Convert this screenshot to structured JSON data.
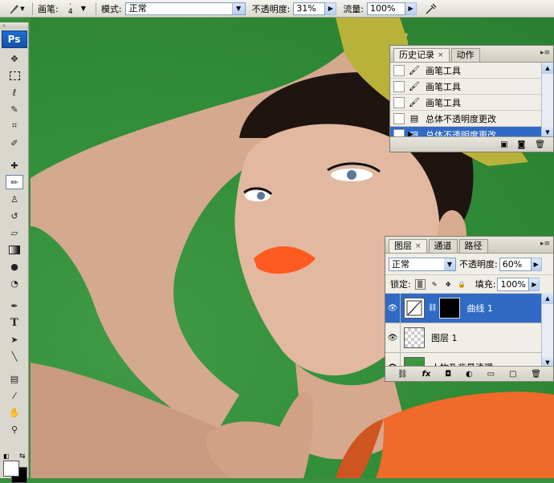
{
  "options_bar": {
    "brush_label": "画笔:",
    "brush_size": "4",
    "mode_label": "模式:",
    "mode_value": "正常",
    "opacity_label": "不透明度:",
    "opacity_value": "31%",
    "flow_label": "流量:",
    "flow_value": "100%"
  },
  "toolbox": {
    "logo": "Ps"
  },
  "history_panel": {
    "tabs": [
      {
        "label": "历史记录",
        "active": true
      },
      {
        "label": "动作",
        "active": false
      }
    ],
    "items": [
      {
        "label": "画笔工具",
        "icon": "brush-icon",
        "selected": false
      },
      {
        "label": "画笔工具",
        "icon": "brush-icon",
        "selected": false
      },
      {
        "label": "画笔工具",
        "icon": "brush-icon",
        "selected": false
      },
      {
        "label": "总体不透明度更改",
        "icon": "history-state-icon",
        "selected": false
      },
      {
        "label": "总体不透明度更改",
        "icon": "history-state-icon",
        "selected": true
      }
    ]
  },
  "layers_panel": {
    "tabs": [
      {
        "label": "图层",
        "active": true
      },
      {
        "label": "通道",
        "active": false
      },
      {
        "label": "路径",
        "active": false
      }
    ],
    "blend_mode": "正常",
    "opacity_label": "不透明度:",
    "opacity_value": "60%",
    "lock_label": "锁定:",
    "fill_label": "填充:",
    "fill_value": "100%",
    "layers": [
      {
        "name": "曲线 1",
        "type": "curves",
        "selected": true
      },
      {
        "name": "图层 1",
        "type": "transparent",
        "selected": false
      },
      {
        "name": "人物及背景清理",
        "type": "photo",
        "selected": false
      }
    ]
  },
  "colors": {
    "background_green": "#2f8a36",
    "selection_blue": "#316ac5",
    "lip_orange": "#ff5a1f",
    "glove_yellow": "#b9b23a",
    "dress_orange": "#f06a2a"
  }
}
